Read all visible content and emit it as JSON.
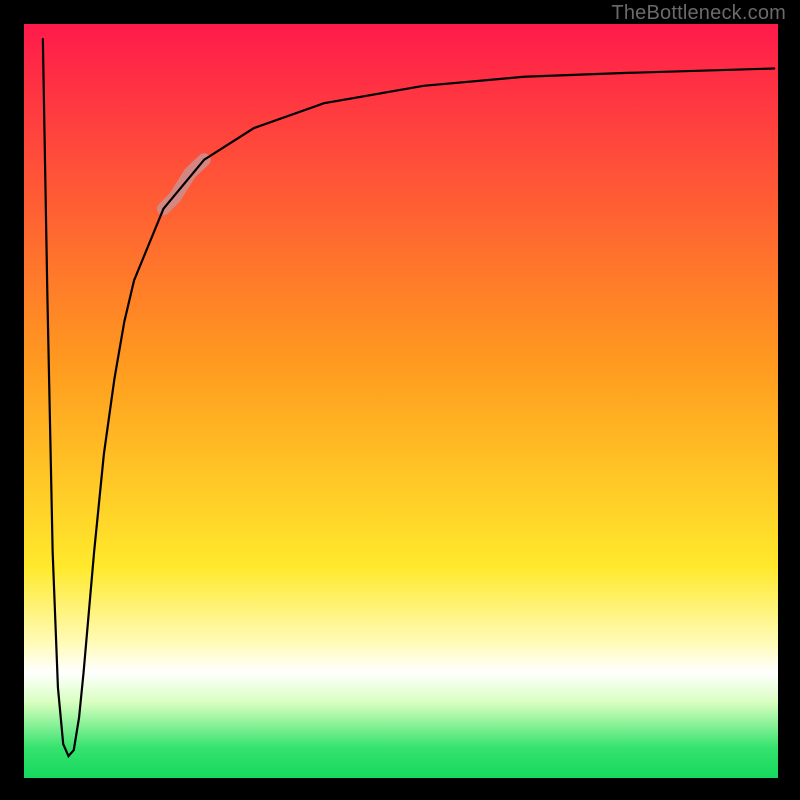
{
  "attribution": "TheBottleneck.com",
  "chart_data": {
    "type": "line",
    "title": "",
    "xlabel": "",
    "ylabel": "",
    "xlim": [
      0,
      100
    ],
    "ylim": [
      0,
      100
    ],
    "gradient_stops": [
      {
        "offset": 0.0,
        "color": "#ff1a4b"
      },
      {
        "offset": 0.45,
        "color": "#ff9a1f"
      },
      {
        "offset": 0.72,
        "color": "#ffe92c"
      },
      {
        "offset": 0.82,
        "color": "#fffbb7"
      },
      {
        "offset": 0.86,
        "color": "#ffffff"
      },
      {
        "offset": 0.9,
        "color": "#d8ffbf"
      },
      {
        "offset": 0.96,
        "color": "#35e36e"
      },
      {
        "offset": 1.0,
        "color": "#17d85e"
      }
    ],
    "series": [
      {
        "name": "curve",
        "x": [
          2.5,
          3.1,
          3.8,
          4.5,
          5.2,
          5.9,
          6.6,
          7.3,
          7.9,
          8.6,
          9.3,
          10.6,
          12.0,
          13.3,
          14.6,
          18.5,
          23.9,
          30.5,
          39.8,
          53.0,
          66.3,
          79.5,
          99.5
        ],
        "y": [
          98.0,
          64.0,
          30.0,
          12.0,
          4.5,
          2.9,
          3.7,
          8.0,
          14.0,
          22.0,
          30.0,
          43.0,
          53.0,
          60.5,
          66.0,
          75.5,
          82.0,
          86.2,
          89.5,
          91.8,
          93.0,
          93.5,
          94.1
        ]
      }
    ],
    "highlight_segment": {
      "x": [
        18.5,
        20.0,
        22.0,
        23.9
      ],
      "y": [
        75.5,
        77.0,
        80.2,
        82.0
      ]
    }
  }
}
